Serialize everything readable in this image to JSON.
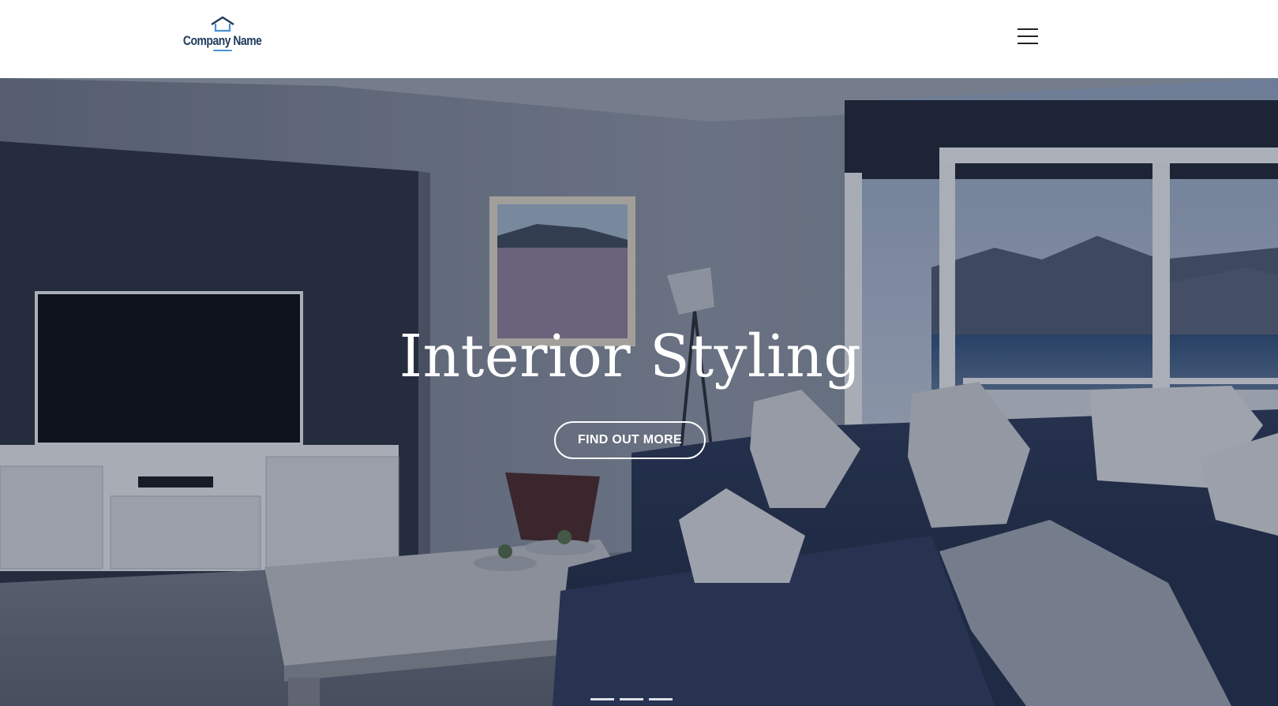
{
  "header": {
    "logo_text": "Company Name",
    "logo_icon": "house-icon",
    "menu_icon": "hamburger-menu-icon"
  },
  "hero": {
    "title": "Interior Styling",
    "cta_label": "FIND OUT MORE",
    "slides_count": 3,
    "overlay_color": "#141c2d"
  },
  "colors": {
    "brand_dark": "#1f3a5c",
    "brand_accent": "#4a90d9"
  }
}
